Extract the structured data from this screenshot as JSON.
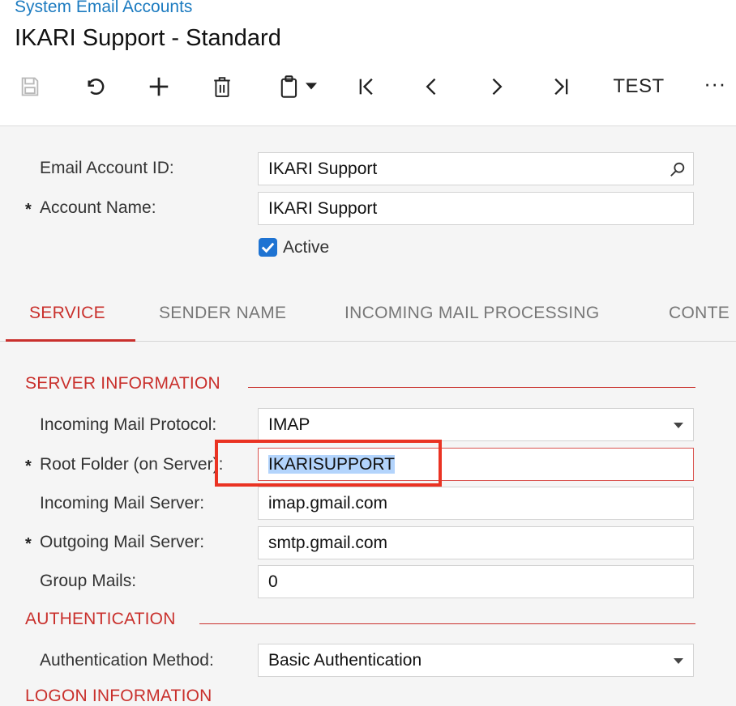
{
  "breadcrumb": "System Email Accounts",
  "title": "IKARI Support - Standard",
  "toolbar": {
    "save_icon": "save-icon",
    "undo_icon": "undo-icon",
    "add_icon": "add-icon",
    "delete_icon": "trash-icon",
    "copy_icon": "clipboard-icon",
    "first_icon": "first-icon",
    "prev_icon": "prev-icon",
    "next_icon": "next-icon",
    "last_icon": "last-icon",
    "test_label": "TEST",
    "more_label": "···"
  },
  "form": {
    "email_account_id": {
      "label": "Email Account ID:",
      "value": "IKARI Support"
    },
    "account_name": {
      "label": "Account Name:",
      "value": "IKARI Support",
      "required": "*"
    },
    "active": {
      "label": "Active",
      "checked": true
    }
  },
  "tabs": [
    "SERVICE",
    "SENDER NAME",
    "INCOMING MAIL PROCESSING",
    "CONTE"
  ],
  "active_tab": "SERVICE",
  "server_information": {
    "title": "SERVER INFORMATION",
    "incoming_protocol": {
      "label": "Incoming Mail Protocol:",
      "value": "IMAP"
    },
    "root_folder": {
      "label": "Root Folder (on Server):",
      "value": "IKARISUPPORT",
      "required": "*"
    },
    "incoming_server": {
      "label": "Incoming Mail Server:",
      "value": "imap.gmail.com"
    },
    "outgoing_server": {
      "label": "Outgoing Mail Server:",
      "value": "smtp.gmail.com",
      "required": "*"
    },
    "group_mails": {
      "label": "Group Mails:",
      "value": "0"
    }
  },
  "authentication": {
    "title": "AUTHENTICATION",
    "method": {
      "label": "Authentication Method:",
      "value": "Basic Authentication"
    }
  },
  "logon_information": {
    "title": "LOGON INFORMATION"
  },
  "colors": {
    "accent": "#c9302c",
    "link": "#1c7bc0",
    "highlight": "#ea3323",
    "checkbox": "#1e73d2"
  }
}
